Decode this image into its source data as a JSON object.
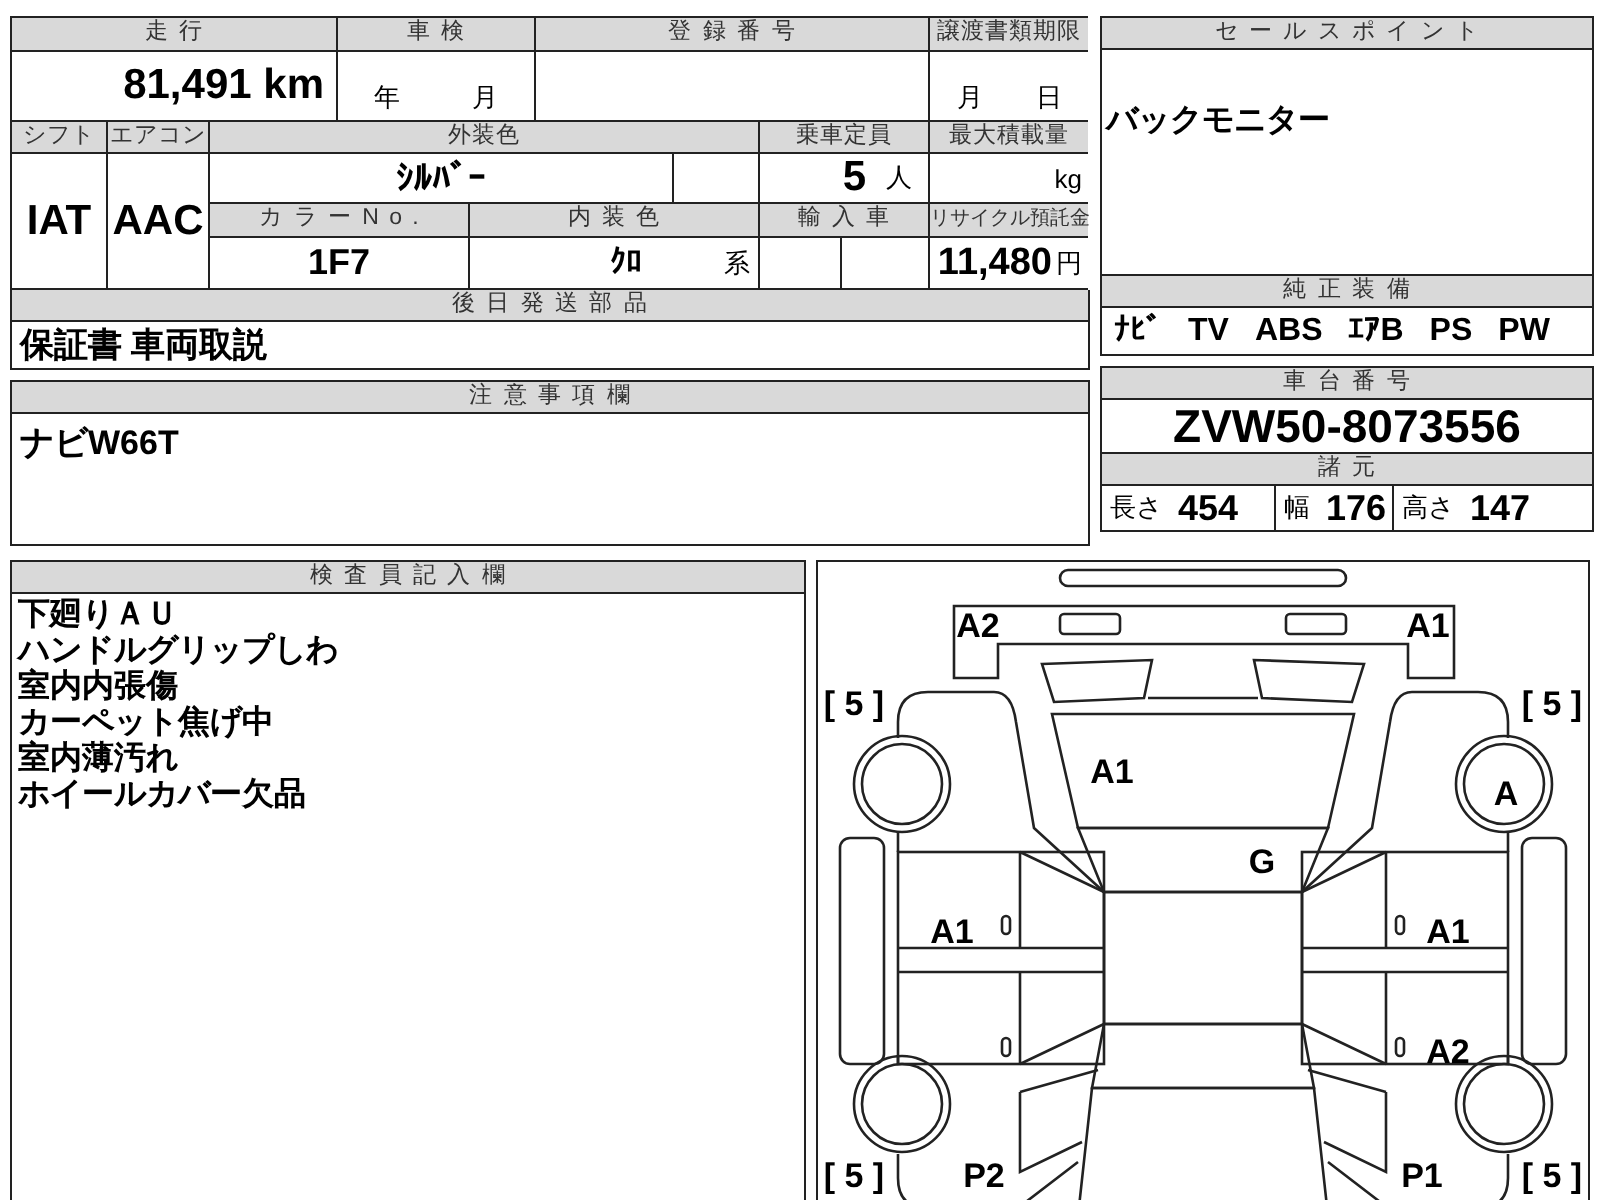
{
  "mileage": {
    "label": "走行",
    "value": "81,491",
    "unit": "km"
  },
  "inspection": {
    "label": "車検",
    "units": [
      "年",
      "月"
    ]
  },
  "registration_number": {
    "label": "登録番号"
  },
  "transfer_deadline": {
    "label": "譲渡書類期限",
    "units": [
      "月",
      "日"
    ]
  },
  "shift": {
    "label": "シフト",
    "value": "IAT"
  },
  "aircon": {
    "label": "エアコン",
    "value": "AAC"
  },
  "exterior_color": {
    "label": "外装色",
    "value": "ｼﾙﾊﾞｰ"
  },
  "capacity": {
    "label": "乗車定員",
    "value": "5",
    "unit": "人"
  },
  "max_load": {
    "label": "最大積載量",
    "unit": "kg"
  },
  "color_no": {
    "label": "カラーNo.",
    "value": "1F7"
  },
  "interior_color": {
    "label": "内装色",
    "value": "ｸﾛ",
    "unit": "系"
  },
  "import_car": {
    "label": "輸入車"
  },
  "recycle_fee": {
    "label": "リサイクル預託金",
    "value": "11,480",
    "unit": "円"
  },
  "later_parts": {
    "label": "後日発送部品",
    "value": "保証書 車両取説"
  },
  "notes": {
    "label": "注意事項欄",
    "value": "ナビW66T"
  },
  "sales_point": {
    "label": "セールスポイント",
    "value": "バックモニター"
  },
  "standard_equipment": {
    "label": "純正装備",
    "items": [
      "ﾅﾋﾞ",
      "TV",
      "ABS",
      "ｴｱB",
      "PS",
      "PW"
    ]
  },
  "chassis_number": {
    "label": "車台番号",
    "value": "ZVW50-8073556"
  },
  "specs": {
    "label": "諸元",
    "items": [
      {
        "label": "長さ",
        "value": "454"
      },
      {
        "label": "幅",
        "value": "176"
      },
      {
        "label": "高さ",
        "value": "147"
      }
    ]
  },
  "inspector_notes": {
    "label": "検査員記入欄",
    "lines": [
      "下廻りＡＵ",
      "ハンドルグリップしわ",
      "室内内張傷",
      "カーペット焦げ中",
      "室内薄汚れ",
      "ホイールカバー欠品"
    ]
  },
  "diagram": {
    "marks": [
      {
        "label": "A2"
      },
      {
        "label": "A1"
      },
      {
        "label": "[ 5 ]"
      },
      {
        "label": "[ 5 ]"
      },
      {
        "label": "A1"
      },
      {
        "label": "A"
      },
      {
        "label": "G"
      },
      {
        "label": "A1"
      },
      {
        "label": "A1"
      },
      {
        "label": "A2"
      },
      {
        "label": "[ 5 ]"
      },
      {
        "label": "P2"
      },
      {
        "label": "P1"
      },
      {
        "label": "[ 5 ]"
      }
    ]
  }
}
